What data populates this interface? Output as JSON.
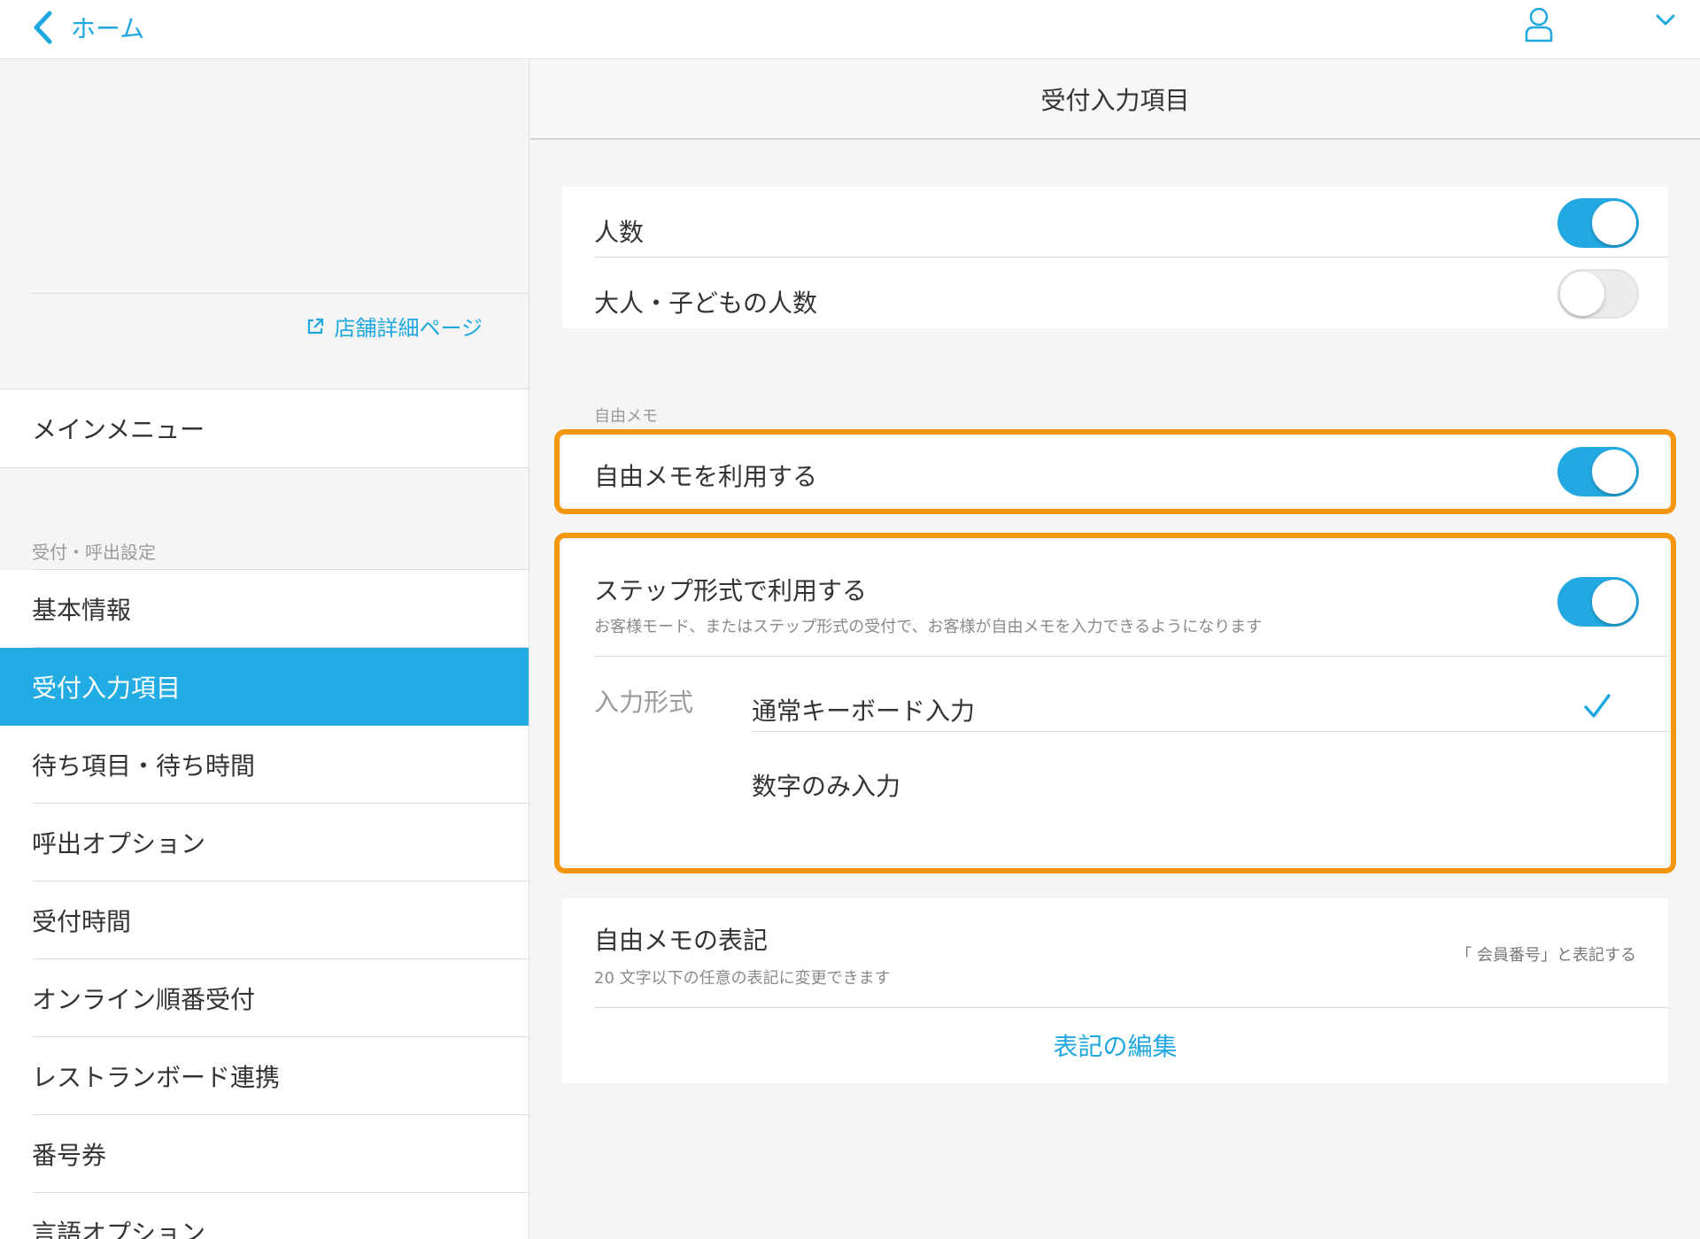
{
  "topbar": {
    "back_label": "ホーム"
  },
  "sidebar": {
    "store_link": "店舗詳細ページ",
    "main_menu": "メインメニュー",
    "section_label": "受付・呼出設定",
    "items": [
      {
        "label": "基本情報"
      },
      {
        "label": "受付入力項目",
        "active": true
      },
      {
        "label": "待ち項目・待ち時間"
      },
      {
        "label": "呼出オプション"
      },
      {
        "label": "受付時間"
      },
      {
        "label": "オンライン順番受付"
      },
      {
        "label": "レストランボード連携"
      },
      {
        "label": "番号券"
      },
      {
        "label": "言語オプション"
      }
    ]
  },
  "page": {
    "title": "受付入力項目",
    "people": {
      "label": "人数",
      "enabled": true
    },
    "adult_child": {
      "label": "大人・子どもの人数",
      "enabled": false
    },
    "memo_section_label": "自由メモ",
    "use_memo": {
      "label": "自由メモを利用する",
      "enabled": true
    },
    "step_mode": {
      "label": "ステップ形式で利用する",
      "description": "お客様モード、またはステップ形式の受付で、お客様が自由メモを入力できるようになります",
      "enabled": true
    },
    "input_format": {
      "label": "入力形式",
      "options": [
        {
          "label": "通常キーボード入力",
          "selected": true
        },
        {
          "label": "数字のみ入力",
          "selected": false
        }
      ]
    },
    "memo_notation": {
      "label": "自由メモの表記",
      "description": "20 文字以下の任意の表記に変更できます",
      "value": "「 会員番号」と表記する",
      "edit_label": "表記の編集"
    }
  },
  "colors": {
    "accent": "#22ace3",
    "highlight": "#f5960f"
  }
}
